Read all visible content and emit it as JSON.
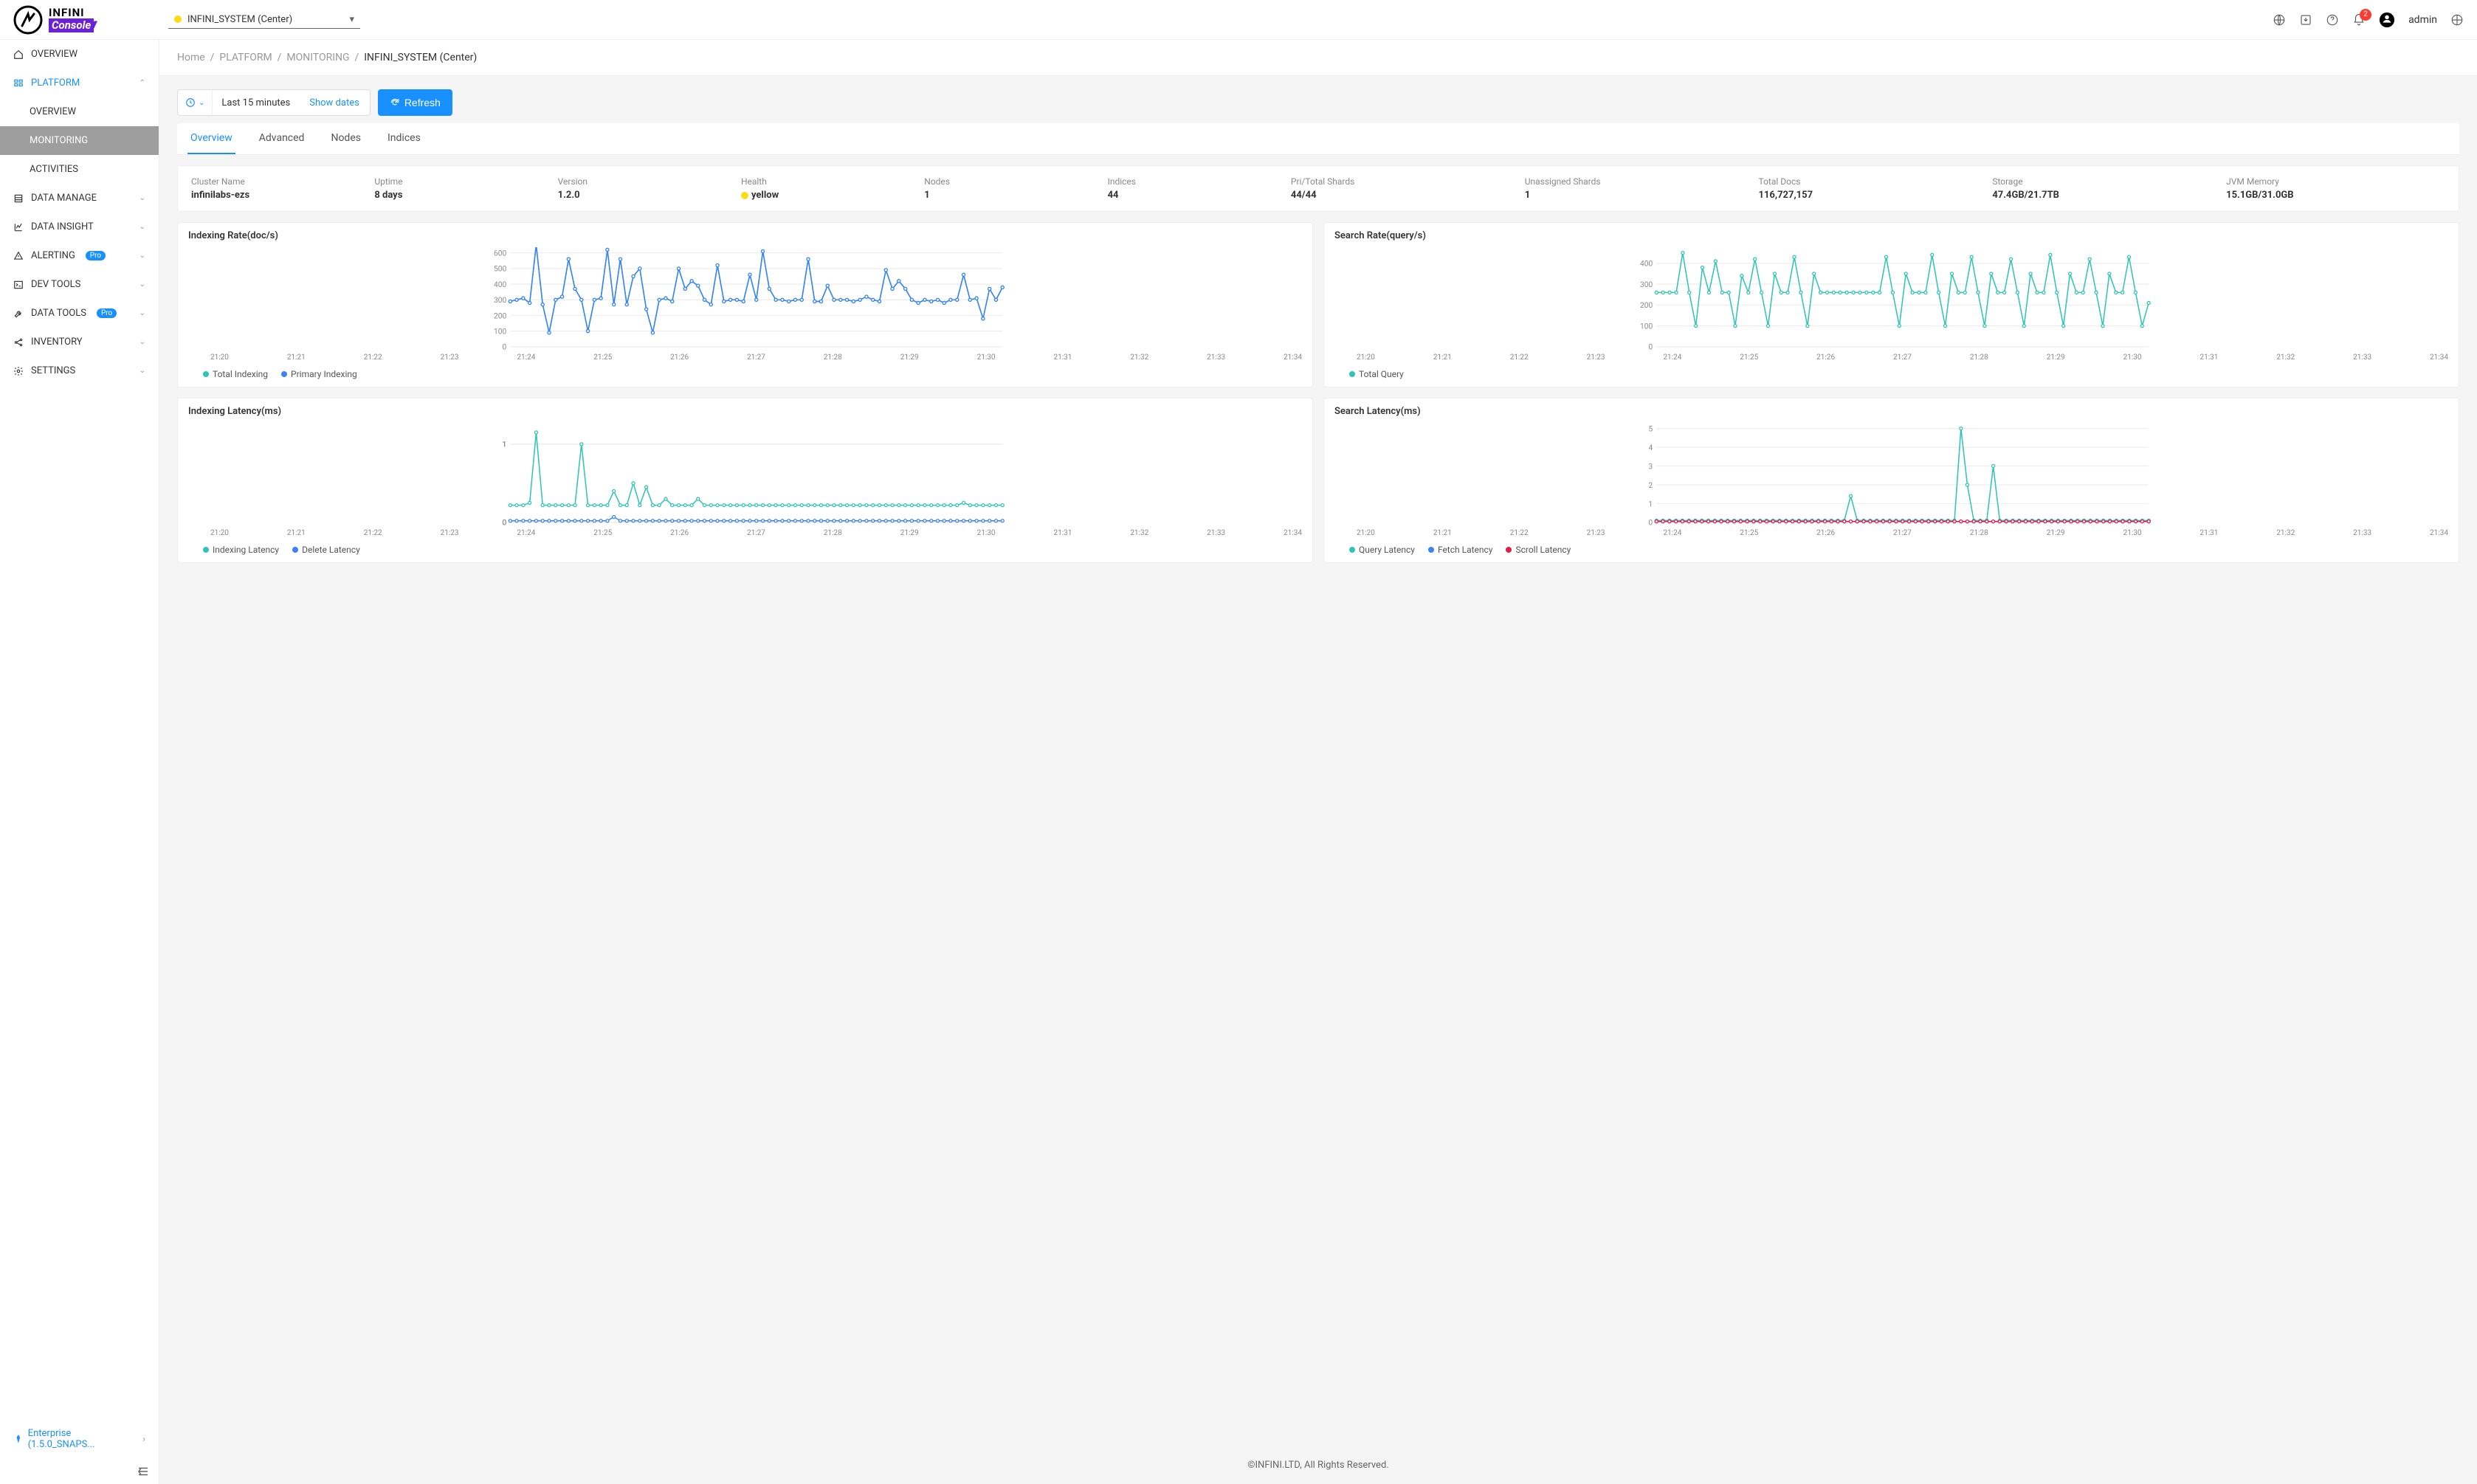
{
  "brand": {
    "name1": "INFINI",
    "name2": "Console"
  },
  "cluster_selector": "INFINI_SYSTEM (Center)",
  "header": {
    "notif_count": "2",
    "username": "admin"
  },
  "sidebar": {
    "overview": "OVERVIEW",
    "platform": "PLATFORM",
    "platform_sub": {
      "overview": "OVERVIEW",
      "monitoring": "MONITORING",
      "activities": "ACTIVITIES"
    },
    "data_manage": "DATA MANAGE",
    "data_insight": "DATA INSIGHT",
    "alerting": "ALERTING",
    "dev_tools": "DEV TOOLS",
    "data_tools": "DATA TOOLS",
    "inventory": "INVENTORY",
    "settings": "SETTINGS",
    "pro": "Pro",
    "enterprise": "Enterprise (1.5.0_SNAPS..."
  },
  "breadcrumb": {
    "home": "Home",
    "platform": "PLATFORM",
    "monitoring": "MONITORING",
    "current": "INFINI_SYSTEM (Center)"
  },
  "controls": {
    "range": "Last 15 minutes",
    "showdates": "Show dates",
    "refresh": "Refresh"
  },
  "tabs": {
    "overview": "Overview",
    "advanced": "Advanced",
    "nodes": "Nodes",
    "indices": "Indices"
  },
  "stats": {
    "cluster_name": {
      "label": "Cluster Name",
      "value": "infinilabs-ezs"
    },
    "uptime": {
      "label": "Uptime",
      "value": "8 days"
    },
    "version": {
      "label": "Version",
      "value": "1.2.0"
    },
    "health": {
      "label": "Health",
      "value": "yellow"
    },
    "nodes": {
      "label": "Nodes",
      "value": "1"
    },
    "indices": {
      "label": "Indices",
      "value": "44"
    },
    "shards": {
      "label": "Pri/Total Shards",
      "value": "44/44"
    },
    "unassigned": {
      "label": "Unassigned Shards",
      "value": "1"
    },
    "docs": {
      "label": "Total Docs",
      "value": "116,727,157"
    },
    "storage": {
      "label": "Storage",
      "value": "47.4GB/21.7TB"
    },
    "jvm": {
      "label": "JVM Memory",
      "value": "15.1GB/31.0GB"
    }
  },
  "footer": "©INFINI.LTD, All Rights Reserved.",
  "chart_data": [
    {
      "id": "indexing_rate",
      "title": "Indexing Rate(doc/s)",
      "type": "line",
      "xlabel": "",
      "ylabel": "",
      "ylim": [
        0,
        600
      ],
      "yticks": [
        0,
        100,
        200,
        300,
        400,
        500,
        600
      ],
      "categories": [
        "21:20",
        "21:21",
        "21:22",
        "21:23",
        "21:24",
        "21:25",
        "21:26",
        "21:27",
        "21:28",
        "21:29",
        "21:30",
        "21:31",
        "21:32",
        "21:33",
        "21:34"
      ],
      "series": [
        {
          "name": "Total Indexing",
          "color": "#2ec4b6",
          "values": [
            290,
            300,
            310,
            280,
            650,
            270,
            90,
            300,
            320,
            560,
            370,
            300,
            100,
            300,
            310,
            620,
            270,
            560,
            270,
            450,
            500,
            240,
            90,
            300,
            310,
            290,
            500,
            370,
            420,
            390,
            300,
            270,
            520,
            290,
            300,
            300,
            290,
            460,
            300,
            610,
            370,
            300,
            300,
            290,
            300,
            300,
            560,
            290,
            290,
            390,
            300,
            300,
            300,
            290,
            300,
            320,
            300,
            290,
            490,
            370,
            420,
            370,
            300,
            280,
            300,
            290,
            300,
            280,
            300,
            300,
            460,
            300,
            310,
            180,
            370,
            300,
            380
          ]
        },
        {
          "name": "Primary Indexing",
          "color": "#3b82f6",
          "values": [
            290,
            300,
            310,
            280,
            650,
            270,
            90,
            300,
            320,
            560,
            370,
            300,
            100,
            300,
            310,
            620,
            270,
            560,
            270,
            450,
            500,
            240,
            90,
            300,
            310,
            290,
            500,
            370,
            420,
            390,
            300,
            270,
            520,
            290,
            300,
            300,
            290,
            460,
            300,
            610,
            370,
            300,
            300,
            290,
            300,
            300,
            560,
            290,
            290,
            390,
            300,
            300,
            300,
            290,
            300,
            320,
            300,
            290,
            490,
            370,
            420,
            370,
            300,
            280,
            300,
            290,
            300,
            280,
            300,
            300,
            460,
            300,
            310,
            180,
            370,
            300,
            380
          ]
        }
      ]
    },
    {
      "id": "search_rate",
      "title": "Search Rate(query/s)",
      "type": "line",
      "ylim": [
        0,
        450
      ],
      "yticks": [
        0,
        100,
        200,
        300,
        400
      ],
      "categories": [
        "21:20",
        "21:21",
        "21:22",
        "21:23",
        "21:24",
        "21:25",
        "21:26",
        "21:27",
        "21:28",
        "21:29",
        "21:30",
        "21:31",
        "21:32",
        "21:33",
        "21:34"
      ],
      "series": [
        {
          "name": "Total Query",
          "color": "#2ec4b6",
          "values": [
            260,
            260,
            260,
            260,
            450,
            260,
            100,
            380,
            260,
            410,
            260,
            260,
            100,
            340,
            260,
            420,
            260,
            100,
            350,
            260,
            260,
            430,
            260,
            100,
            350,
            260,
            260,
            260,
            260,
            260,
            260,
            260,
            260,
            260,
            260,
            430,
            260,
            100,
            350,
            260,
            260,
            260,
            440,
            260,
            100,
            350,
            260,
            260,
            430,
            260,
            100,
            350,
            260,
            260,
            420,
            260,
            100,
            350,
            260,
            260,
            440,
            260,
            100,
            350,
            260,
            260,
            420,
            260,
            100,
            350,
            260,
            260,
            430,
            260,
            100,
            210
          ]
        }
      ]
    },
    {
      "id": "indexing_latency",
      "title": "Indexing Latency(ms)",
      "type": "line",
      "ylim": [
        0,
        1.2
      ],
      "yticks": [
        0,
        0,
        0,
        1,
        1,
        1
      ],
      "categories": [
        "21:20",
        "21:21",
        "21:22",
        "21:23",
        "21:24",
        "21:25",
        "21:26",
        "21:27",
        "21:28",
        "21:29",
        "21:30",
        "21:31",
        "21:32",
        "21:33",
        "21:34"
      ],
      "series": [
        {
          "name": "Indexing Latency",
          "color": "#2ec4b6",
          "values": [
            0.22,
            0.22,
            0.22,
            0.25,
            1.15,
            0.22,
            0.22,
            0.22,
            0.22,
            0.22,
            0.22,
            1.0,
            0.22,
            0.22,
            0.22,
            0.22,
            0.4,
            0.22,
            0.22,
            0.5,
            0.22,
            0.45,
            0.22,
            0.22,
            0.3,
            0.22,
            0.22,
            0.22,
            0.22,
            0.3,
            0.22,
            0.22,
            0.22,
            0.22,
            0.22,
            0.22,
            0.22,
            0.22,
            0.22,
            0.22,
            0.22,
            0.22,
            0.22,
            0.22,
            0.22,
            0.22,
            0.22,
            0.22,
            0.22,
            0.22,
            0.22,
            0.22,
            0.22,
            0.22,
            0.22,
            0.22,
            0.22,
            0.22,
            0.22,
            0.22,
            0.22,
            0.22,
            0.22,
            0.22,
            0.22,
            0.22,
            0.22,
            0.22,
            0.22,
            0.22,
            0.25,
            0.22,
            0.22,
            0.22,
            0.22,
            0.22,
            0.22
          ]
        },
        {
          "name": "Delete Latency",
          "color": "#3b82f6",
          "values": [
            0.02,
            0.02,
            0.02,
            0.02,
            0.02,
            0.02,
            0.02,
            0.02,
            0.02,
            0.02,
            0.02,
            0.02,
            0.02,
            0.02,
            0.02,
            0.02,
            0.07,
            0.02,
            0.02,
            0.02,
            0.02,
            0.02,
            0.02,
            0.02,
            0.02,
            0.02,
            0.02,
            0.02,
            0.02,
            0.02,
            0.02,
            0.02,
            0.02,
            0.02,
            0.02,
            0.02,
            0.02,
            0.02,
            0.02,
            0.02,
            0.02,
            0.02,
            0.02,
            0.02,
            0.02,
            0.02,
            0.02,
            0.02,
            0.02,
            0.02,
            0.02,
            0.02,
            0.02,
            0.02,
            0.02,
            0.02,
            0.02,
            0.02,
            0.02,
            0.02,
            0.02,
            0.02,
            0.02,
            0.02,
            0.02,
            0.02,
            0.02,
            0.02,
            0.02,
            0.02,
            0.02,
            0.02,
            0.02,
            0.02,
            0.02,
            0.02,
            0.02
          ]
        }
      ]
    },
    {
      "id": "search_latency",
      "title": "Search Latency(ms)",
      "type": "line",
      "ylim": [
        0,
        5
      ],
      "yticks": [
        0,
        1,
        2,
        3,
        4,
        5
      ],
      "categories": [
        "21:20",
        "21:21",
        "21:22",
        "21:23",
        "21:24",
        "21:25",
        "21:26",
        "21:27",
        "21:28",
        "21:29",
        "21:30",
        "21:31",
        "21:32",
        "21:33",
        "21:34"
      ],
      "series": [
        {
          "name": "Query Latency",
          "color": "#2ec4b6",
          "values": [
            0.1,
            0.1,
            0.1,
            0.1,
            0.1,
            0.1,
            0.1,
            0.1,
            0.1,
            0.1,
            0.1,
            0.1,
            0.1,
            0.1,
            0.1,
            0.1,
            0.1,
            0.1,
            0.1,
            0.1,
            0.1,
            0.1,
            0.1,
            0.1,
            0.1,
            0.1,
            0.1,
            0.1,
            0.1,
            0.1,
            1.4,
            0.1,
            0.1,
            0.1,
            0.1,
            0.1,
            0.1,
            0.1,
            0.1,
            0.1,
            0.1,
            0.1,
            0.1,
            0.1,
            0.1,
            0.1,
            0.1,
            5.0,
            2.0,
            0.1,
            0.1,
            0.1,
            3.0,
            0.1,
            0.1,
            0.1,
            0.1,
            0.1,
            0.1,
            0.1,
            0.1,
            0.1,
            0.1,
            0.1,
            0.1,
            0.1,
            0.1,
            0.1,
            0.1,
            0.1,
            0.1,
            0.1,
            0.1,
            0.1,
            0.1,
            0.1,
            0.1
          ]
        },
        {
          "name": "Fetch Latency",
          "color": "#3b82f6",
          "values": [
            0.05,
            0.05,
            0.05,
            0.05,
            0.05,
            0.05,
            0.05,
            0.05,
            0.05,
            0.05,
            0.05,
            0.05,
            0.05,
            0.05,
            0.05,
            0.05,
            0.05,
            0.05,
            0.05,
            0.05,
            0.05,
            0.05,
            0.05,
            0.05,
            0.05,
            0.05,
            0.05,
            0.05,
            0.05,
            0.05,
            0.05,
            0.05,
            0.05,
            0.05,
            0.05,
            0.05,
            0.05,
            0.05,
            0.05,
            0.05,
            0.05,
            0.05,
            0.05,
            0.05,
            0.05,
            0.05,
            0.05,
            0.05,
            0.05,
            0.05,
            0.05,
            0.05,
            0.05,
            0.05,
            0.05,
            0.05,
            0.05,
            0.05,
            0.05,
            0.05,
            0.05,
            0.05,
            0.05,
            0.05,
            0.05,
            0.05,
            0.05,
            0.05,
            0.05,
            0.05,
            0.05,
            0.05,
            0.05,
            0.05,
            0.05,
            0.05,
            0.05
          ]
        },
        {
          "name": "Scroll Latency",
          "color": "#e11d48",
          "values": [
            0.05,
            0.05,
            0.05,
            0.05,
            0.05,
            0.05,
            0.05,
            0.05,
            0.05,
            0.05,
            0.05,
            0.05,
            0.05,
            0.05,
            0.05,
            0.05,
            0.05,
            0.05,
            0.05,
            0.05,
            0.05,
            0.05,
            0.05,
            0.05,
            0.05,
            0.05,
            0.05,
            0.05,
            0.05,
            0.05,
            0.05,
            0.05,
            0.05,
            0.05,
            0.05,
            0.05,
            0.05,
            0.05,
            0.05,
            0.05,
            0.05,
            0.05,
            0.05,
            0.05,
            0.05,
            0.05,
            0.05,
            0.05,
            0.05,
            0.05,
            0.05,
            0.05,
            0.05,
            0.05,
            0.05,
            0.05,
            0.05,
            0.05,
            0.05,
            0.05,
            0.05,
            0.05,
            0.05,
            0.05,
            0.05,
            0.05,
            0.05,
            0.05,
            0.05,
            0.05,
            0.05,
            0.05,
            0.05,
            0.05,
            0.05,
            0.05,
            0.05
          ]
        }
      ]
    }
  ]
}
